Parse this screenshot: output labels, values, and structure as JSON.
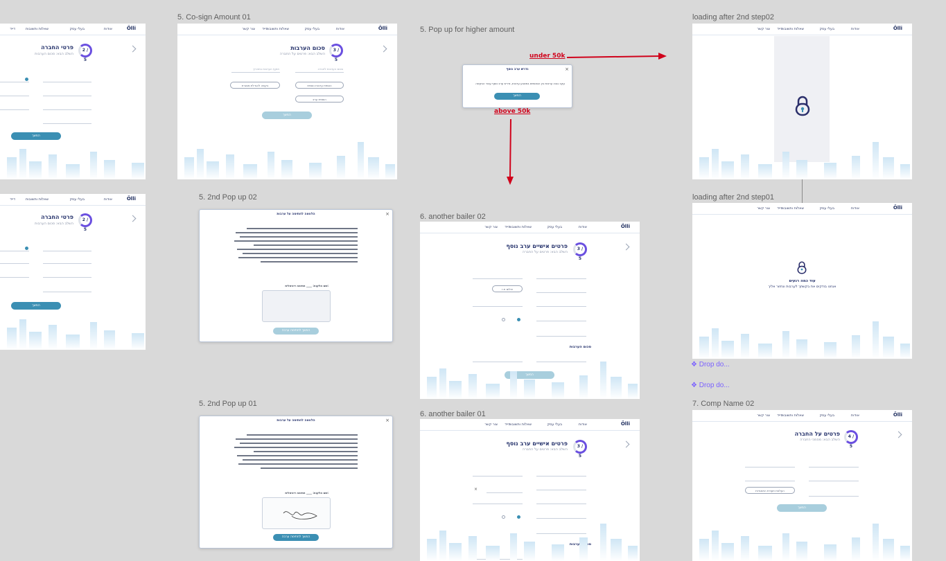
{
  "labels": {
    "cosign": "5. Co-sign Amount 01",
    "popup_higher": "5. Pop up for higher amount",
    "loading02": "loading after 2nd step02",
    "loading01": "loading after 2nd step01",
    "popup2nd02": "5. 2nd Pop up 02",
    "popup2nd01": "5. 2nd Pop up 01",
    "bailer02": "6. another bailer 02",
    "bailer01": "6. another bailer 01",
    "compname02": "7. Comp Name 02"
  },
  "arrows": {
    "under": "under 50k",
    "above": "above 50k"
  },
  "dropdowns": [
    "❖ Drop do...",
    "❖ Drop do..."
  ],
  "colors": {
    "accent": "#3b8fb3",
    "arrow": "#d0021b",
    "navy": "#23306a",
    "purple": "#6a4fe0"
  },
  "nav": {
    "logo": "Ölli",
    "i1": "אודות",
    "i2": "בעלי עסק",
    "i3": "שאלות ותשובות",
    "i4": "דייד",
    "i5": "צור קשר"
  },
  "company": {
    "title": "פרטי החברה",
    "sub": "השלב הבא: סכום הערבות",
    "step": "2 / 5",
    "btn": "המשך"
  },
  "cosign": {
    "title": "סכום הערבות",
    "sub": "השלב הבא: פרטים על החברה",
    "step": "3 / 5",
    "f1": "סכום הערבות לחברה",
    "f2": "תוקף הערבות בתאריך",
    "b1": "הוספת ערבות נוספת",
    "b2": "בקשה להגדלת מסגרת",
    "b3": "הוספת ערב",
    "btn": "המשך"
  },
  "higher": {
    "title": "נדרש ערב נוסף",
    "body": "עקב גובה ערבות בין הסכומים במטבע ערבות, נדרש ערב נוסף עבור הבקשה",
    "btn": "המשך"
  },
  "loading": {
    "title1": "עוד כמה רגעים",
    "title2": "אנחנו בודקים את בקשתך לערבות ונחזור אליך"
  },
  "popup2": {
    "title": "הלוואה לחתימה על ערבות",
    "sign_label": "שם הלקוח: ____ חתימה דיגיטלית:",
    "btn": "המשך לחתימה ערבה"
  },
  "bailer": {
    "title": "פרטים אישיים ערב נוסף",
    "sub": "השלב הבא: פרטים על החברה",
    "step": "3 / 5",
    "section": "סכום הערבות",
    "f_upload": "צילום ת.ז",
    "btn": "המשך"
  },
  "comp7": {
    "title": "פרטים על החברה",
    "sub": "השלב הבא: מסמכי החברה",
    "step": "4 / 5",
    "f_upload": "העלאת תעודת התאגדות",
    "btn": "המשך"
  }
}
